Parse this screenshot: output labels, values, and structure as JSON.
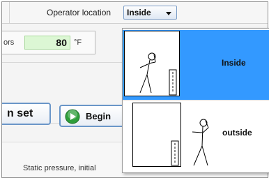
{
  "header": {
    "operator_label": "Operator location",
    "operator_value": "Inside"
  },
  "fields": {
    "label_fragment": "ors",
    "value": "80",
    "unit": "°F"
  },
  "buttons": {
    "set_label": "n set",
    "begin_label": "Begin"
  },
  "footer": {
    "static_label": "Static pressure, initial"
  },
  "dropdown": {
    "options": [
      {
        "label": "Inside",
        "selected": true
      },
      {
        "label": "outside",
        "selected": false
      }
    ]
  },
  "colors": {
    "selection": "#3399ff",
    "input_bg": "#dcf7d4",
    "button_border": "#6a96c8",
    "play_icon": "#2e9e3a"
  }
}
